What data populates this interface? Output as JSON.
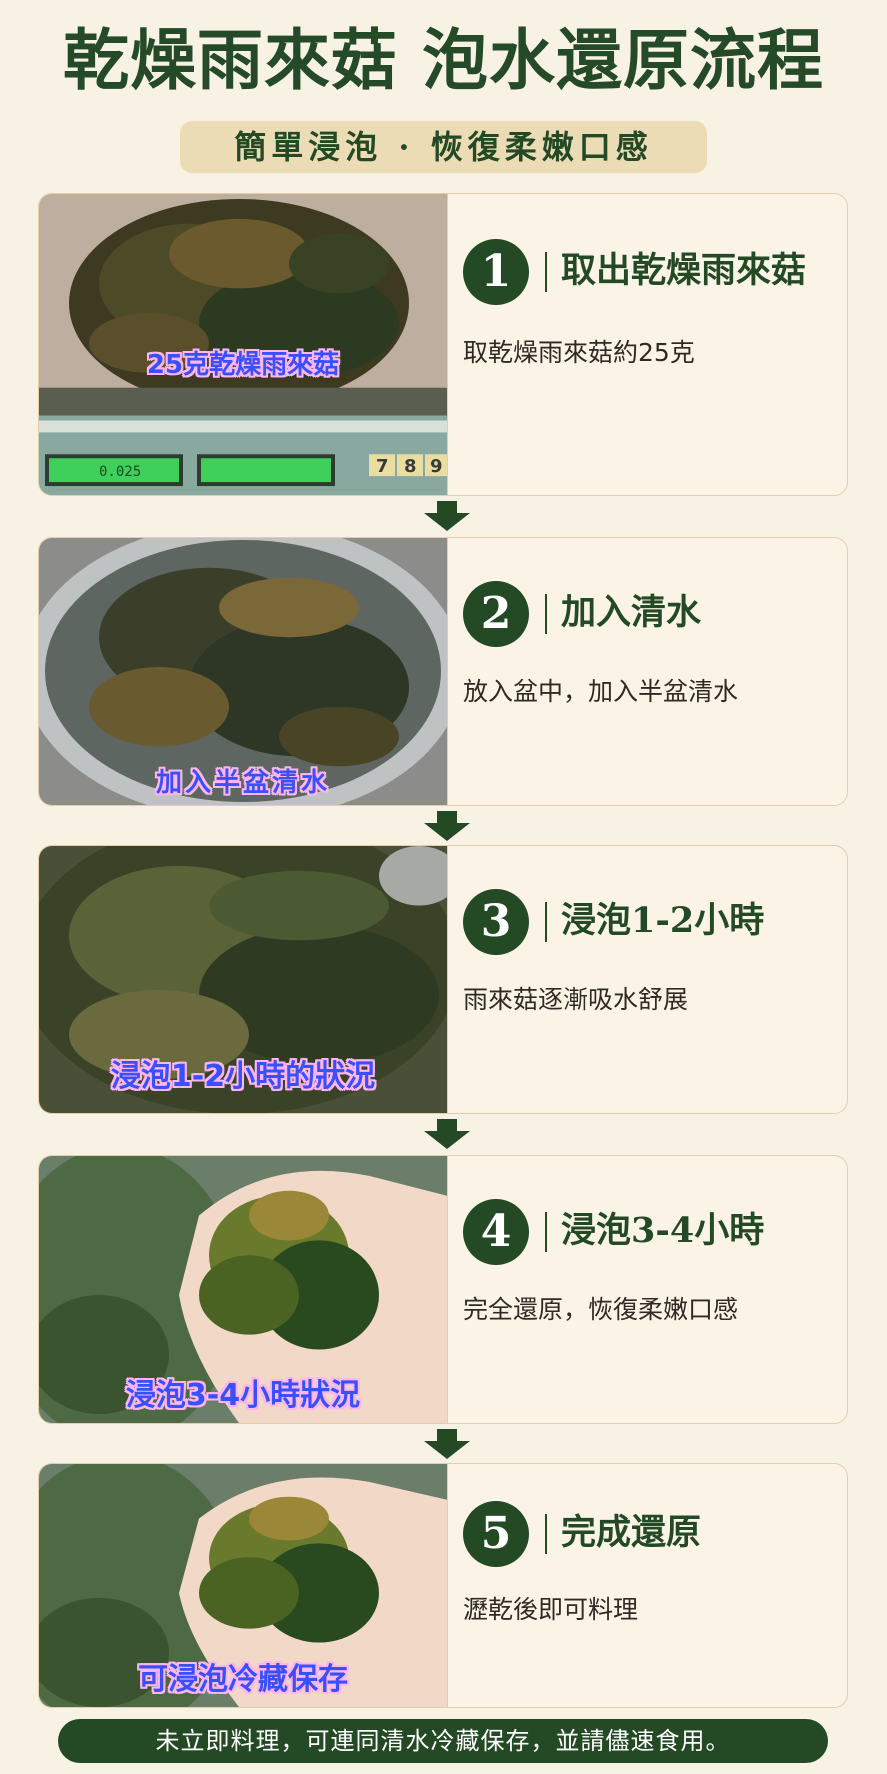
{
  "header": {
    "title": "乾燥雨來菇 泡水還原流程",
    "subtitle": "簡單浸泡 · 恢復柔嫩口感"
  },
  "steps": [
    {
      "number": "1",
      "title": "取出乾燥雨來菇",
      "description": "取乾燥雨來菇約25克",
      "photo_caption": "25克乾燥雨來菇",
      "scale_readout": "0.025",
      "scale_keys": [
        "7",
        "8",
        "9"
      ]
    },
    {
      "number": "2",
      "title": "加入清水",
      "description": "放入盆中，加入半盆清水",
      "photo_caption": "加入半盆清水"
    },
    {
      "number": "3",
      "title": "浸泡1-2小時",
      "description": "雨來菇逐漸吸水舒展",
      "photo_caption": "浸泡1-2小時的狀況"
    },
    {
      "number": "4",
      "title": "浸泡3-4小時",
      "description": "完全還原，恢復柔嫩口感",
      "photo_caption": "浸泡3-4小時狀況"
    },
    {
      "number": "5",
      "title": "完成還原",
      "description": "瀝乾後即可料理",
      "photo_caption": "可浸泡冷藏保存"
    }
  ],
  "footer": {
    "note": "未立即料理，可連同清水冷藏保存，並請儘速食用。"
  },
  "colors": {
    "background": "#f8f2e4",
    "primary_green": "#234a25",
    "subtitle_bg": "#ecdcb6",
    "card_border": "#e3cfa6",
    "caption_text": "#3850ff",
    "caption_outline": "#ffb6ee"
  },
  "icons": [
    "down-arrow-icon"
  ]
}
